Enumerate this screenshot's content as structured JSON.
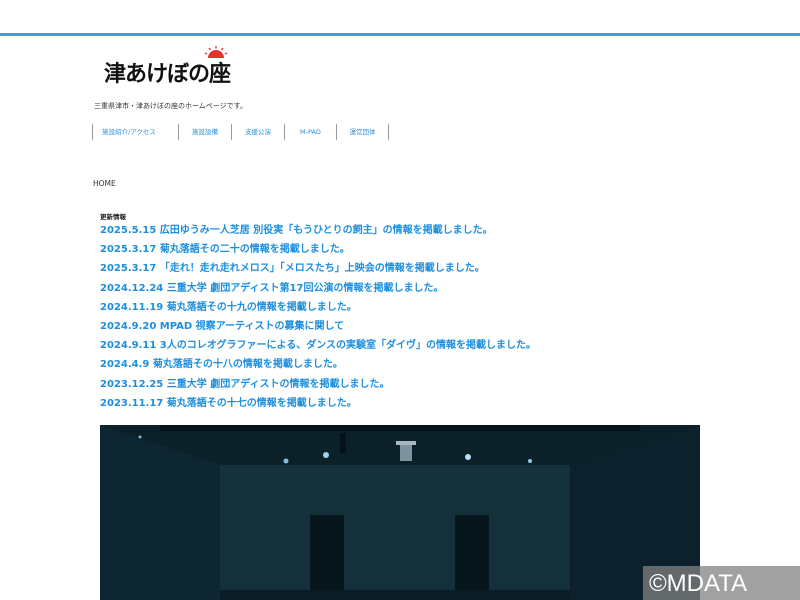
{
  "site": {
    "logo_text": "津あけぼの座",
    "tagline": "三重県津市・津あけぼの座のホームページです。"
  },
  "nav": {
    "items": [
      "施設紹介/アクセス",
      "施設設備",
      "支援公演",
      "M-PAD",
      "運営団体"
    ]
  },
  "breadcrumb": "HOME",
  "news": {
    "heading": "更新情報",
    "items": [
      "2025.5.15 広田ゆうみ一人芝居 別役実「もうひとりの飼主」の情報を掲載しました。",
      "2025.3.17 菊丸落語その二十の情報を掲載しました。",
      "2025.3.17 「走れ！走れ走れメロス」「メロスたち」上映会の情報を掲載しました。",
      "2024.12.24 三重大学 劇団アディスト第17回公演の情報を掲載しました。",
      "2024.11.19 菊丸落語その十九の情報を掲載しました。",
      "2024.9.20 MPAD 視察アーティストの募集に関して",
      "2024.9.11 3人のコレオグラファーによる、ダンスの実験室「ダイヴ」の情報を掲載しました。",
      "2024.4.9 菊丸落語その十八の情報を掲載しました。",
      "2023.12.25 三重大学 劇団アディストの情報を掲載しました。",
      "2023.11.17 菊丸落語その十七の情報を掲載しました。"
    ]
  },
  "watermark": "©MDATA",
  "colors": {
    "accent_bar": "#3b9fe6",
    "link": "#1e8fde",
    "logo_sun": "#e8332a"
  },
  "icons": {
    "logo_sun": "sun-icon"
  }
}
